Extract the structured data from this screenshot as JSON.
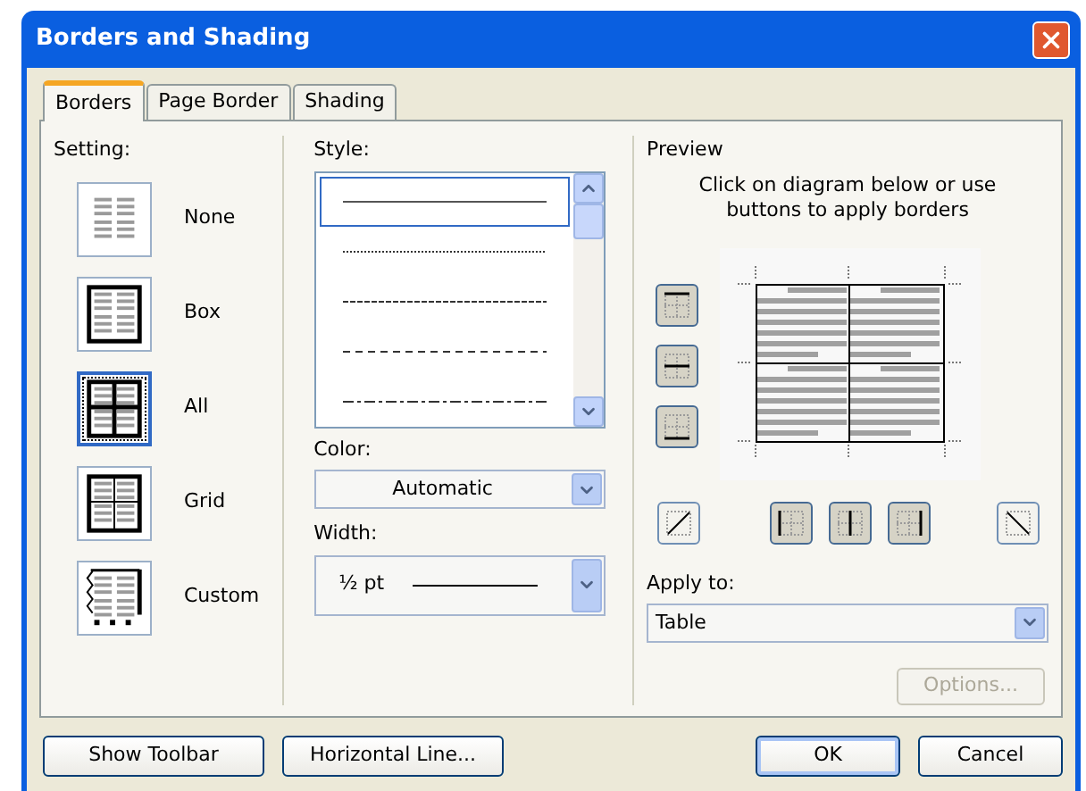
{
  "window": {
    "title": "Borders and Shading"
  },
  "tabs": [
    {
      "label": "Borders",
      "selected": true
    },
    {
      "label": "Page Border",
      "selected": false
    },
    {
      "label": "Shading",
      "selected": false
    }
  ],
  "setting": {
    "label": "Setting:",
    "options": [
      {
        "label": "None",
        "kind": "none",
        "selected": false
      },
      {
        "label": "Box",
        "kind": "box",
        "selected": false
      },
      {
        "label": "All",
        "kind": "all",
        "selected": true
      },
      {
        "label": "Grid",
        "kind": "grid",
        "selected": false
      },
      {
        "label": "Custom",
        "kind": "custom",
        "selected": false
      }
    ]
  },
  "style": {
    "label": "Style:",
    "items": [
      {
        "kind": "solid",
        "selected": true
      },
      {
        "kind": "dotted",
        "selected": false
      },
      {
        "kind": "fine-dashed",
        "selected": false
      },
      {
        "kind": "dashed",
        "selected": false
      },
      {
        "kind": "dash-dot",
        "selected": false
      }
    ]
  },
  "color": {
    "label": "Color:",
    "value": "Automatic"
  },
  "width": {
    "label": "Width:",
    "value": "½ pt"
  },
  "preview": {
    "label": "Preview",
    "hint": "Click on diagram below or use buttons to apply borders",
    "side_buttons": [
      {
        "kind": "top",
        "on": true
      },
      {
        "kind": "middle",
        "on": true
      },
      {
        "kind": "bottom",
        "on": true
      }
    ],
    "bottom_buttons": [
      {
        "kind": "diag-up",
        "on": false
      },
      {
        "kind": "left",
        "on": true
      },
      {
        "kind": "center",
        "on": true
      },
      {
        "kind": "right",
        "on": true
      },
      {
        "kind": "diag-down",
        "on": false
      }
    ]
  },
  "apply_to": {
    "label": "Apply to:",
    "value": "Table"
  },
  "options_button": {
    "label": "Options...",
    "disabled": true
  },
  "buttons": [
    {
      "label": "Show Toolbar"
    },
    {
      "label": "Horizontal Line..."
    },
    {
      "label": "OK",
      "default": true
    },
    {
      "label": "Cancel"
    }
  ]
}
